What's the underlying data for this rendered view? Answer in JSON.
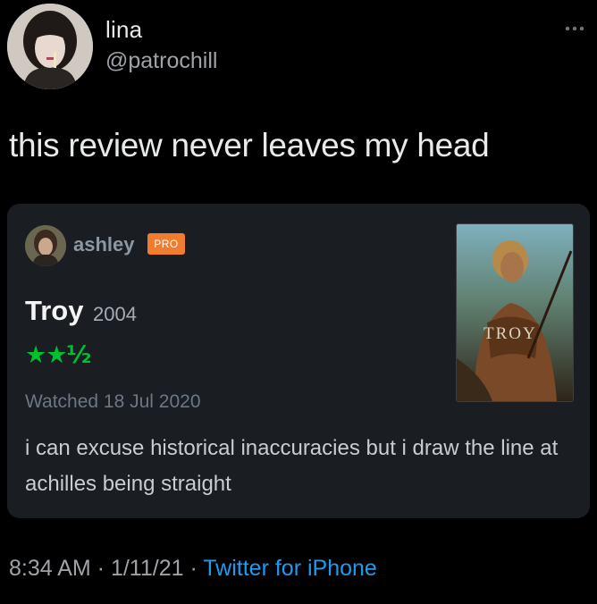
{
  "tweet": {
    "display_name": "lina",
    "handle": "@patrochill",
    "text": "this review never leaves my head",
    "time": "8:34 AM",
    "separator": " · ",
    "date": "1/11/21",
    "source": "Twitter for iPhone",
    "more_icon": "more-horizontal-icon"
  },
  "review_card": {
    "reviewer_name": "ashley",
    "badge": "PRO",
    "film_title": "Troy",
    "film_year": "2004",
    "rating_text": "★★½",
    "rating_value": 2.5,
    "rating_max": 5,
    "watched_text": "Watched 18 Jul 2020",
    "body": "i can excuse historical inaccuracies but i draw the line at achilles being straight",
    "poster_title": "TROY"
  },
  "colors": {
    "background": "#000000",
    "card": "#1a1d22",
    "link": "#1d9bf0",
    "stars": "#00c030",
    "pro_badge": "#f07d2f"
  }
}
